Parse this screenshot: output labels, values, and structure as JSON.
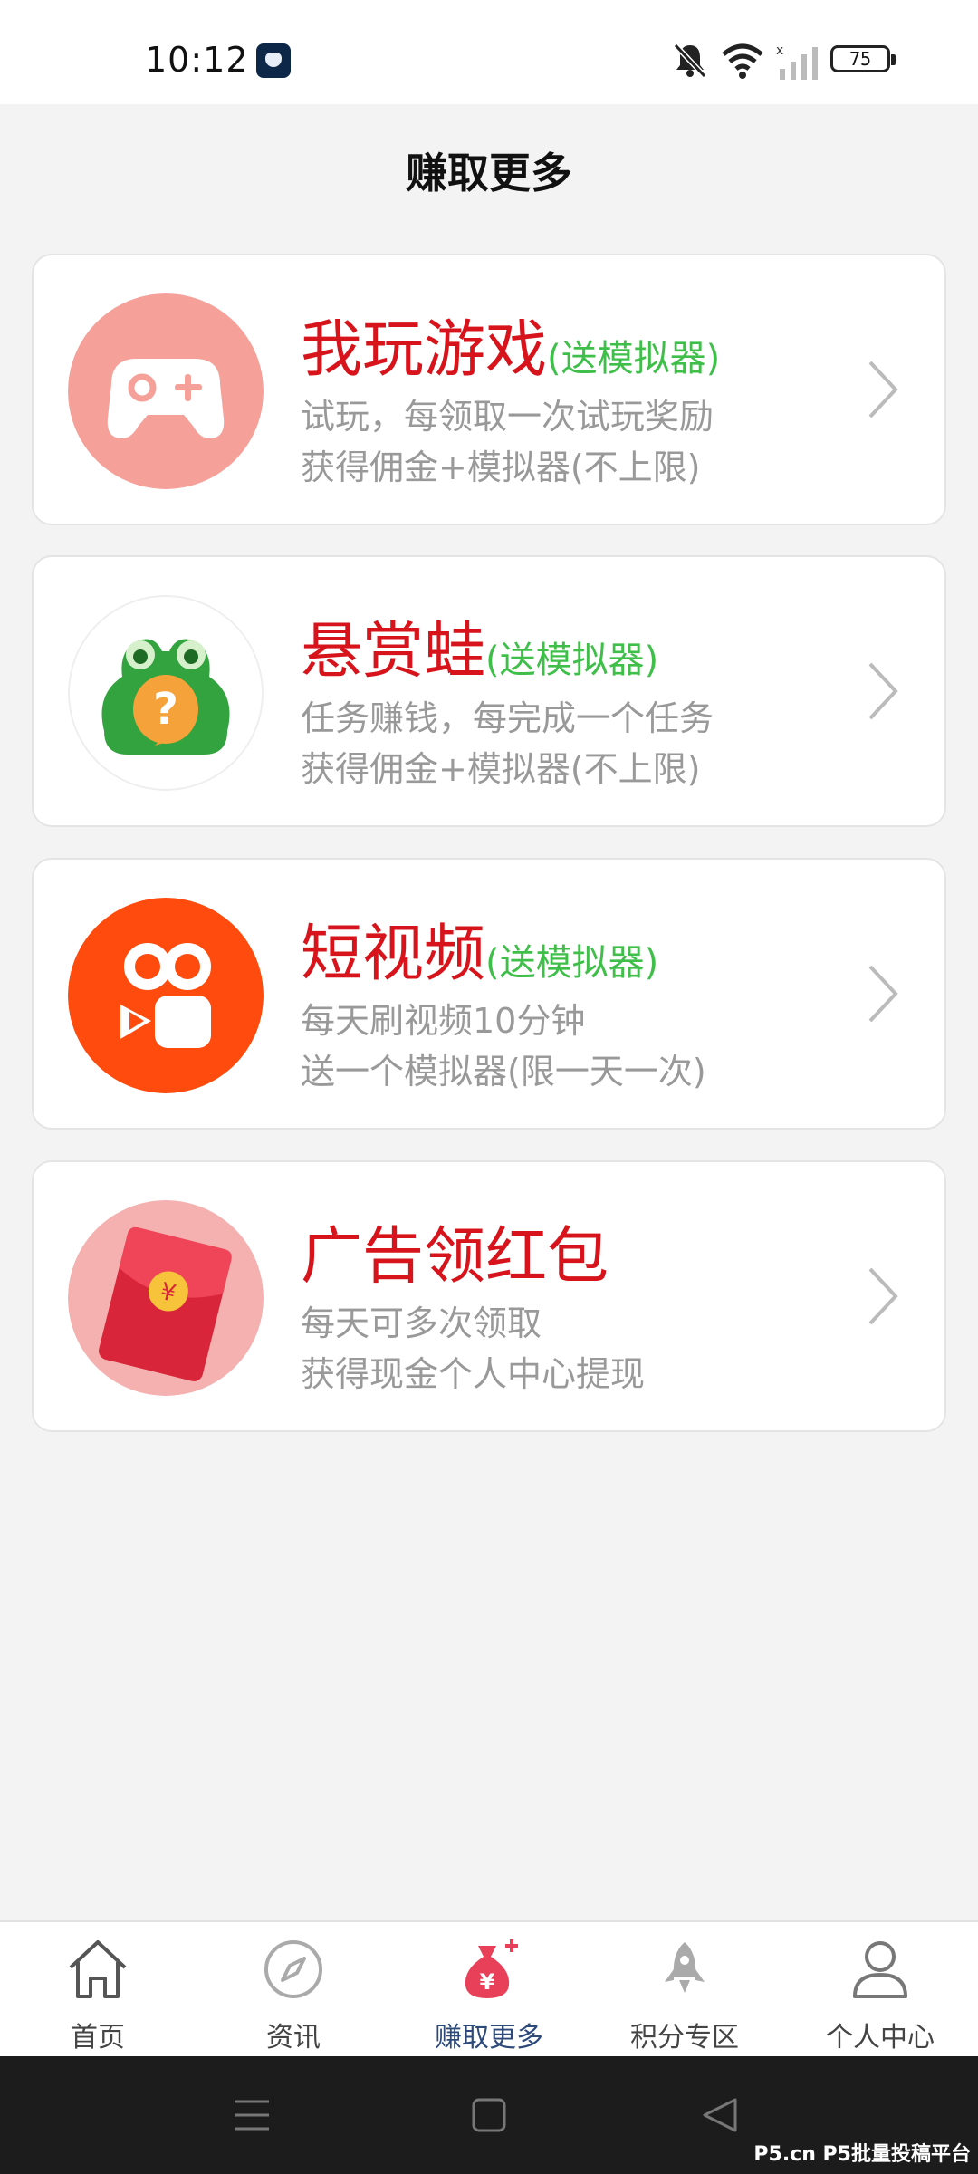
{
  "status_bar": {
    "time": "10:12",
    "battery": "75"
  },
  "header": {
    "title": "赚取更多"
  },
  "cards": [
    {
      "title": "我玩游戏",
      "gift": "(送模拟器)",
      "desc1": "试玩，每领取一次试玩奖励",
      "desc2": "获得佣金+模拟器(不上限)",
      "icon": "gamepad-icon"
    },
    {
      "title": "悬赏蛙",
      "gift": "(送模拟器)",
      "desc1": "任务赚钱，每完成一个任务",
      "desc2": "获得佣金+模拟器(不上限)",
      "icon": "frog-icon"
    },
    {
      "title": "短视频",
      "gift": "(送模拟器)",
      "desc1": "每天刷视频10分钟",
      "desc2": "送一个模拟器(限一天一次)",
      "icon": "video-camera-icon"
    },
    {
      "title": "广告领红包",
      "gift": "",
      "desc1": "每天可多次领取",
      "desc2": "获得现金个人中心提现",
      "icon": "red-envelope-icon"
    }
  ],
  "tabbar": {
    "items": [
      {
        "label": "首页",
        "icon": "home-icon"
      },
      {
        "label": "资讯",
        "icon": "compass-icon"
      },
      {
        "label": "赚取更多",
        "icon": "money-bag-icon"
      },
      {
        "label": "积分专区",
        "icon": "rocket-icon"
      },
      {
        "label": "个人中心",
        "icon": "person-icon"
      }
    ],
    "active_index": 2
  },
  "watermark": "P5.cn P5批量投稿平台",
  "colors": {
    "title_red": "#d7141b",
    "gift_green": "#3fbf4a",
    "desc_gray": "#999999",
    "active_tab": "#2d4a7a"
  }
}
